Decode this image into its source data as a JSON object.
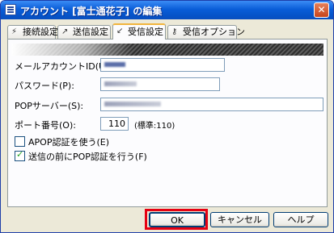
{
  "window": {
    "title": "アカウント [富士通花子] の編集",
    "close_glyph": "✕"
  },
  "tabs": [
    {
      "label": "接続設定",
      "icon": "plug-icon",
      "glyph": "⚡"
    },
    {
      "label": "送信設定",
      "icon": "send-icon",
      "glyph": "↗"
    },
    {
      "label": "受信設定",
      "icon": "receive-icon",
      "glyph": "↙",
      "active": true
    },
    {
      "label": "受信オプション",
      "icon": "key-icon",
      "glyph": "⚷"
    }
  ],
  "form": {
    "mail_account_id_label": "メールアカウントID(U):",
    "password_label": "パスワード(P):",
    "pop_server_label": "POPサーバー(S):",
    "port_label": "ポート番号(O):",
    "port_value": "110",
    "port_note": "(標準:110)",
    "apop_label": "APOP認証を使う(E)",
    "apop_checked": false,
    "pop_before_label": "送信の前にPOP認証を行う(F)",
    "pop_before_checked": true
  },
  "buttons": {
    "ok": "OK",
    "cancel": "キャンセル",
    "help": "ヘルプ"
  },
  "colors": {
    "title_bar": "#0a5ed8",
    "active_tab_accent": "#f1b43c",
    "highlight": "#e60012"
  }
}
